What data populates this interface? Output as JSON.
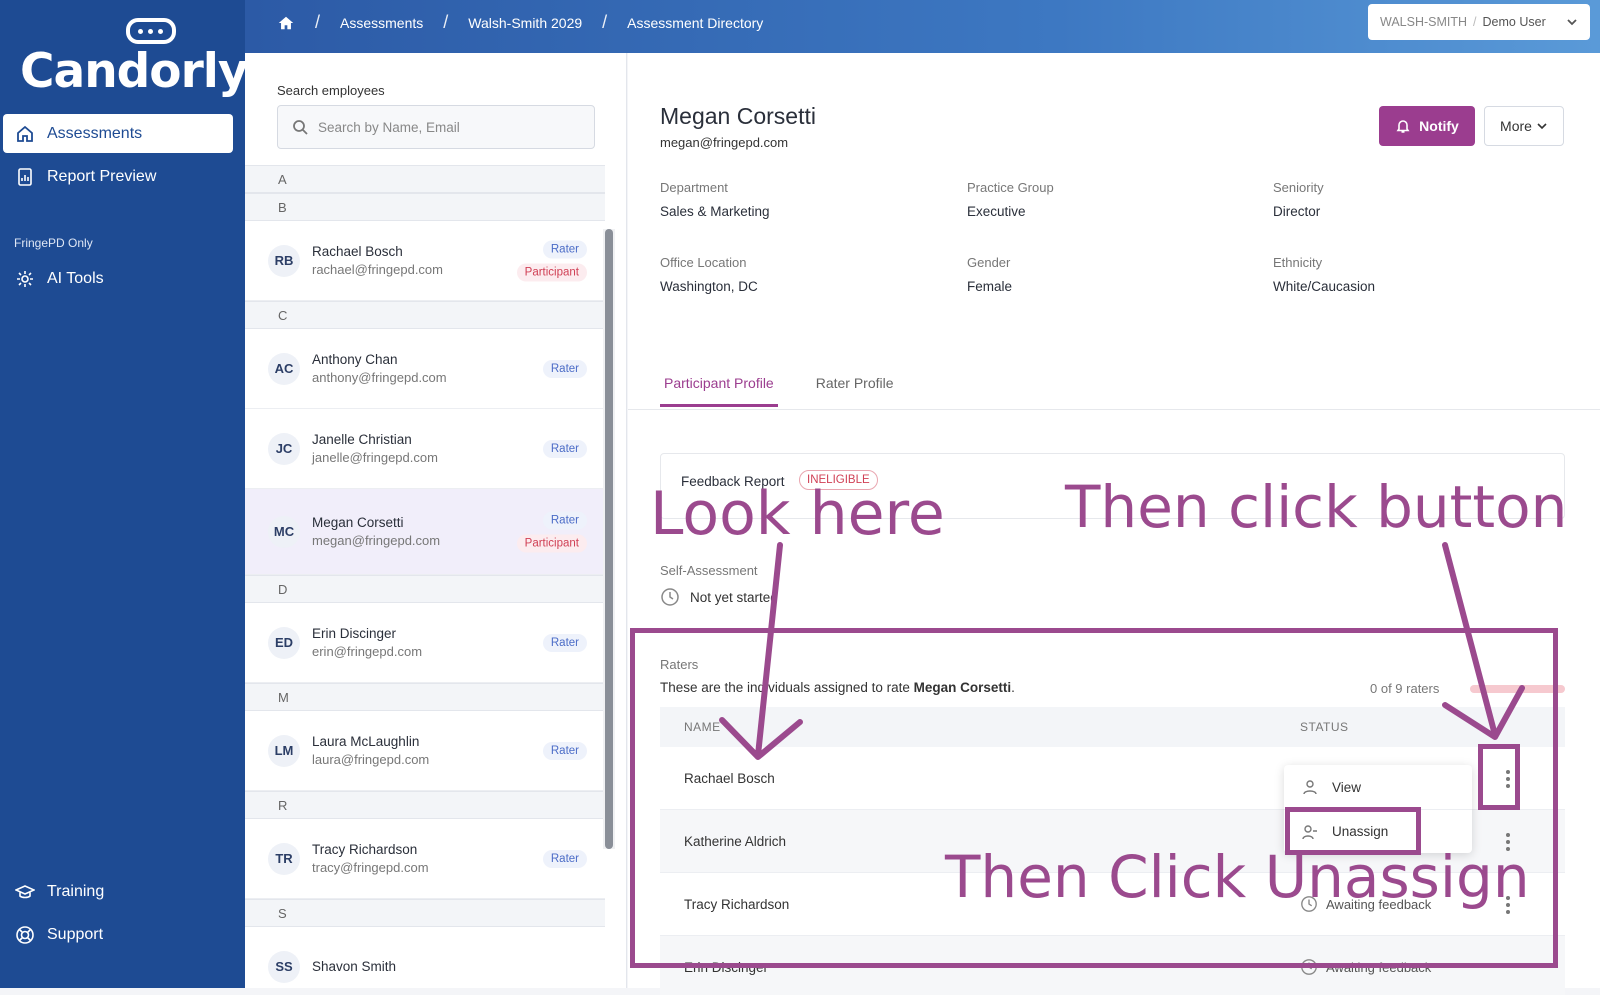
{
  "app": {
    "logo_text": "Candorly"
  },
  "sidebar": {
    "items": [
      {
        "label": "Assessments",
        "icon": "home-icon"
      },
      {
        "label": "Report Preview",
        "icon": "report-icon"
      }
    ],
    "section_label": "FringePD Only",
    "section_items": [
      {
        "label": "AI Tools",
        "icon": "ai-tools-icon"
      }
    ],
    "bottom_items": [
      {
        "label": "Training",
        "icon": "graduation-cap-icon"
      },
      {
        "label": "Support",
        "icon": "lifebuoy-icon"
      }
    ]
  },
  "topbar": {
    "breadcrumbs": [
      "Assessments",
      "Walsh-Smith 2029",
      "Assessment Directory"
    ],
    "user_menu": {
      "org": "WALSH-SMITH",
      "user": "Demo User"
    }
  },
  "employee_panel": {
    "search_label": "Search employees",
    "search_placeholder": "Search by Name, Email",
    "groups": [
      {
        "letter": "A",
        "employees": []
      },
      {
        "letter": "B",
        "employees": [
          {
            "initials": "RB",
            "name": "Rachael Bosch",
            "email": "rachael@fringepd.com",
            "badges": [
              "Rater",
              "Participant"
            ]
          }
        ]
      },
      {
        "letter": "C",
        "employees": [
          {
            "initials": "AC",
            "name": "Anthony Chan",
            "email": "anthony@fringepd.com",
            "badges": [
              "Rater"
            ]
          },
          {
            "initials": "JC",
            "name": "Janelle Christian",
            "email": "janelle@fringepd.com",
            "badges": [
              "Rater"
            ]
          },
          {
            "initials": "MC",
            "name": "Megan Corsetti",
            "email": "megan@fringepd.com",
            "badges": [
              "Rater",
              "Participant"
            ],
            "selected": true
          }
        ]
      },
      {
        "letter": "D",
        "employees": [
          {
            "initials": "ED",
            "name": "Erin Discinger",
            "email": "erin@fringepd.com",
            "badges": [
              "Rater"
            ]
          }
        ]
      },
      {
        "letter": "M",
        "employees": [
          {
            "initials": "LM",
            "name": "Laura McLaughlin",
            "email": "laura@fringepd.com",
            "badges": [
              "Rater"
            ]
          }
        ]
      },
      {
        "letter": "R",
        "employees": [
          {
            "initials": "TR",
            "name": "Tracy Richardson",
            "email": "tracy@fringepd.com",
            "badges": [
              "Rater"
            ]
          }
        ]
      },
      {
        "letter": "S",
        "employees": [
          {
            "initials": "SS",
            "name": "Shavon Smith",
            "email": "",
            "badges": []
          }
        ]
      }
    ]
  },
  "person": {
    "name": "Megan Corsetti",
    "email": "megan@fringepd.com",
    "notify_label": "Notify",
    "more_label": "More",
    "fields": [
      {
        "key": "Department",
        "value": "Sales & Marketing"
      },
      {
        "key": "Practice Group",
        "value": "Executive"
      },
      {
        "key": "Seniority",
        "value": "Director"
      },
      {
        "key": "Office Location",
        "value": "Washington, DC"
      },
      {
        "key": "Gender",
        "value": "Female"
      },
      {
        "key": "Ethnicity",
        "value": "White/Caucasion"
      }
    ]
  },
  "tabs": [
    "Participant Profile",
    "Rater Profile"
  ],
  "feedback_report": {
    "label": "Feedback Report",
    "status": "INELIGIBLE"
  },
  "self_assessment": {
    "label": "Self-Assessment",
    "status": "Not yet started"
  },
  "raters": {
    "label": "Raters",
    "desc_prefix": "These are the individuals assigned to rate ",
    "desc_name": "Megan Corsetti",
    "desc_suffix": ".",
    "count": "0 of 9 raters",
    "progress": 0,
    "columns": [
      "NAME",
      "STATUS"
    ],
    "rows": [
      {
        "name": "Rachael Bosch",
        "status": ""
      },
      {
        "name": "Katherine Aldrich",
        "status": ""
      },
      {
        "name": "Tracy Richardson",
        "status": "Awaiting feedback"
      },
      {
        "name": "Erin Discinger",
        "status": "Awaiting feedback"
      }
    ],
    "menu": [
      {
        "label": "View",
        "icon": "user-icon"
      },
      {
        "label": "Unassign",
        "icon": "user-minus-icon"
      }
    ]
  },
  "annotations": {
    "look_here": "Look here",
    "click_button": "Then click button",
    "click_unassign": "Then Click Unassign",
    "color": "#9b4a8e"
  }
}
